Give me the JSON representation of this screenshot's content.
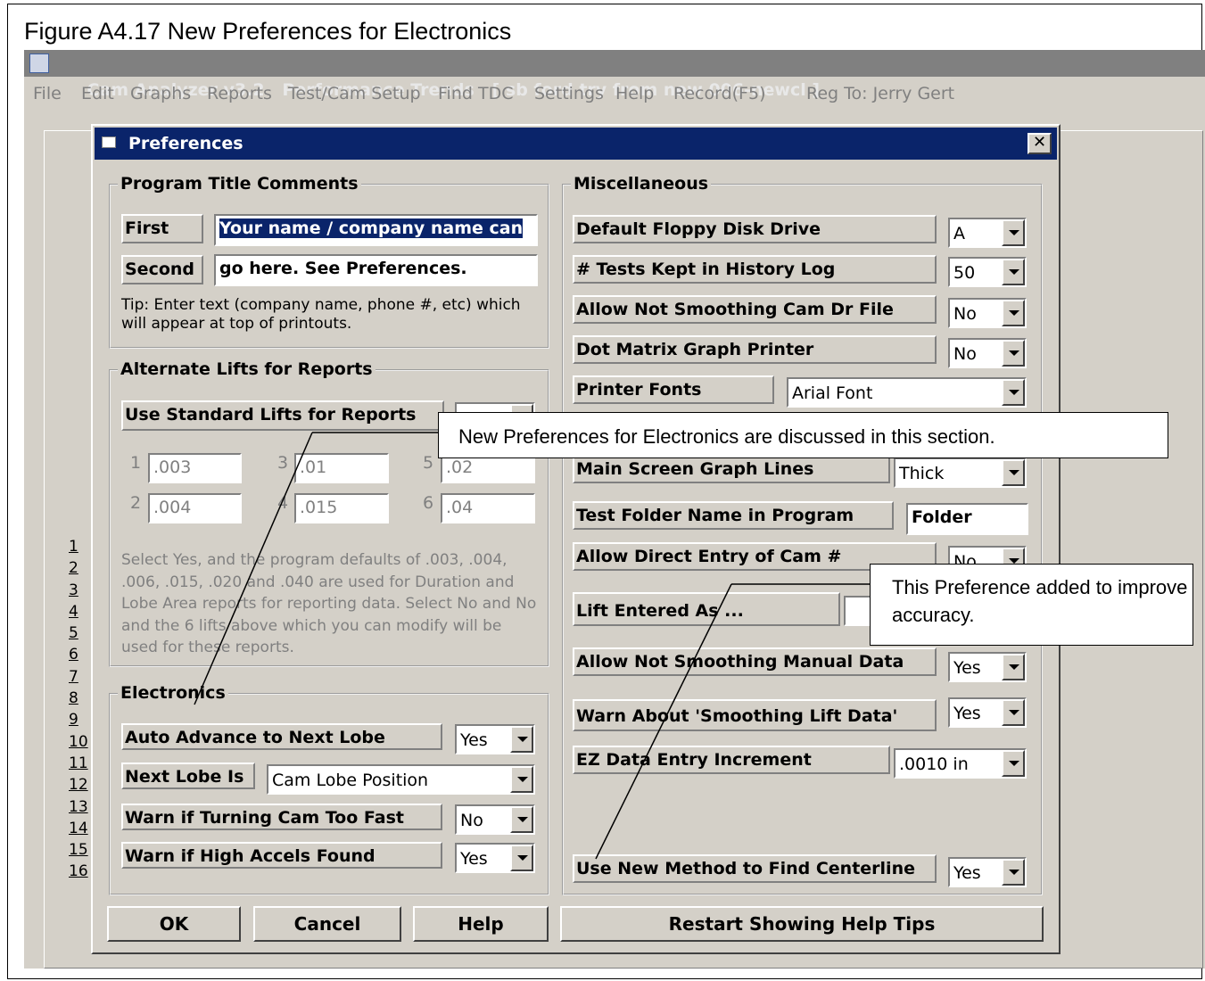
{
  "figure": {
    "caption": "Figure A4.17 New Preferences for Electronics"
  },
  "app": {
    "title": "Cam Analyzer v3.2   Performance Trends   [ sb ford try from new 006-newcl ]",
    "menu": [
      "File",
      "Edit",
      "Graphs",
      "Reports",
      "Test/Cam Setup",
      "Find TDC",
      "Settings",
      "Help",
      "Record(F5)",
      "Reg To: Jerry Gert"
    ],
    "background": {
      "row_numbers": [
        "1",
        "2",
        "3",
        "4",
        "5",
        "6",
        "7",
        "8",
        "9",
        "10",
        "11",
        "12",
        "13",
        "14",
        "15",
        "16"
      ]
    }
  },
  "dialog": {
    "title": "Preferences",
    "close_label": "✕",
    "program_title": {
      "heading": "Program Title Comments",
      "first_label": "First",
      "first_value": "Your name / company name can",
      "second_label": "Second",
      "second_value": "go here.  See Preferences.",
      "tip": "Tip:  Enter text (company name, phone #, etc) which will appear at top of printouts."
    },
    "alt_lifts": {
      "heading": "Alternate Lifts for Reports",
      "use_standard_label": "Use Standard Lifts for Reports",
      "lifts": [
        {
          "n": "1",
          "v": ".003"
        },
        {
          "n": "3",
          "v": ".01"
        },
        {
          "n": "5",
          "v": ".02"
        },
        {
          "n": "2",
          "v": ".004"
        },
        {
          "n": "4",
          "v": ".015"
        },
        {
          "n": "6",
          "v": ".04"
        }
      ],
      "help": "Select Yes, and the program defaults of .003, .004, .006, .015, .020 and .040 are used for Duration and Lobe Area reports for reporting data.  Select No and No and the 6 lifts above which you can modify will be used for these reports."
    },
    "electronics": {
      "heading": "Electronics",
      "auto_advance_label": "Auto Advance to Next Lobe",
      "auto_advance_value": "Yes",
      "next_lobe_label": "Next Lobe Is",
      "next_lobe_value": "Cam Lobe Position",
      "warn_turning_label": "Warn if Turning Cam Too Fast",
      "warn_turning_value": "No",
      "warn_accels_label": "Warn if High Accels Found",
      "warn_accels_value": "Yes"
    },
    "misc": {
      "heading": "Miscellaneous",
      "floppy_label": "Default Floppy Disk Drive",
      "floppy_value": "A",
      "tests_kept_label": "# Tests Kept in History Log",
      "tests_kept_value": "50",
      "allow_not_smoothing_cam_label": "Allow Not Smoothing Cam Dr File",
      "allow_not_smoothing_cam_value": "No",
      "dot_matrix_label": "Dot Matrix Graph Printer",
      "dot_matrix_value": "No",
      "printer_fonts_label": "Printer Fonts",
      "printer_fonts_value": "Arial Font",
      "graph_lines_label": "Main Screen Graph Lines",
      "graph_lines_value": "Thick",
      "test_folder_label": "Test Folder Name in Program",
      "test_folder_value": "Folder",
      "direct_entry_label": "Allow Direct Entry of Cam #",
      "direct_entry_value": "No",
      "lift_entered_label": "Lift Entered As ...",
      "allow_manual_label": "Allow Not Smoothing Manual Data",
      "allow_manual_value": "Yes",
      "warn_smoothing_label": "Warn About 'Smoothing Lift Data'",
      "warn_smoothing_value": "Yes",
      "ez_increment_label": "EZ Data Entry Increment",
      "ez_increment_value": ".0010 in",
      "new_method_label": "Use New Method to Find Centerline",
      "new_method_value": "Yes"
    },
    "buttons": {
      "ok": "OK",
      "cancel": "Cancel",
      "help": "Help",
      "restart": "Restart Showing Help Tips"
    }
  },
  "callouts": {
    "electronics": "New Preferences for Electronics are discussed in this section.",
    "accuracy": "This Preference added to improve accuracy."
  }
}
